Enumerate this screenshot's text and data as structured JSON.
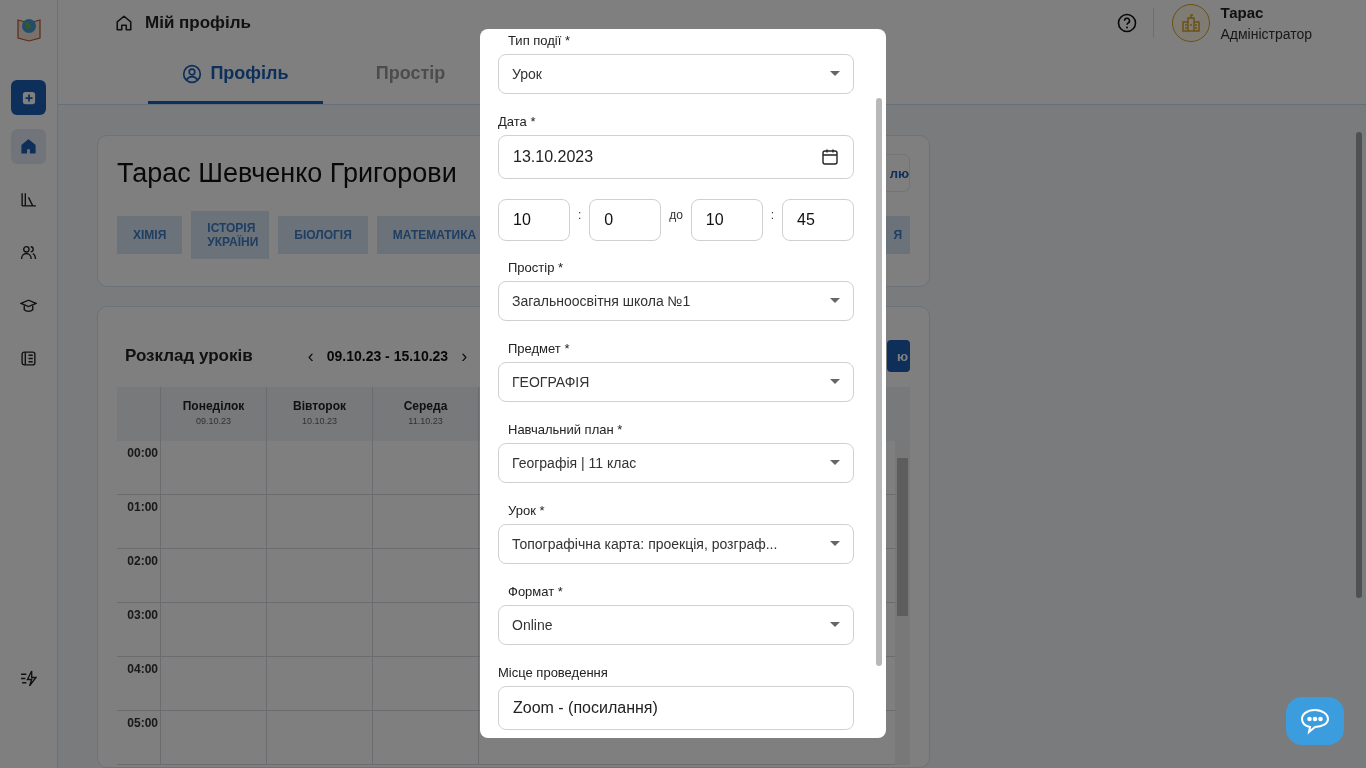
{
  "sidebar": {
    "items": [
      {
        "kind": "add",
        "selected": false
      },
      {
        "kind": "home",
        "selected": true
      },
      {
        "kind": "library",
        "selected": false
      },
      {
        "kind": "people",
        "selected": false
      },
      {
        "kind": "graduation",
        "selected": false
      },
      {
        "kind": "journal",
        "selected": false
      }
    ],
    "footer": {
      "kind": "flash"
    }
  },
  "header": {
    "title": "Мій профіль",
    "user": {
      "name": "Тарас",
      "role": "Адміністратор"
    }
  },
  "tabs": [
    {
      "label": "Профіль",
      "selected": true
    },
    {
      "label": "Простір",
      "selected": false
    }
  ],
  "profile": {
    "name": "Тарас Шевченко Григорови",
    "action": "лю",
    "tags": [
      "ХІМІЯ",
      "ІСТОРІЯ УКРАЇНИ",
      "БІОЛОГІЯ",
      "МАТЕМАТИКА"
    ],
    "tag_fragment": "Я"
  },
  "schedule": {
    "title": "Розклад уроків",
    "prev": "‹",
    "range": "09.10.23 - 15.10.23",
    "next": "›",
    "button": "ю",
    "days": [
      {
        "name": "Понеділок",
        "date": "09.10.23"
      },
      {
        "name": "Вівторок",
        "date": "10.10.23"
      },
      {
        "name": "Середа",
        "date": "11.10.23"
      }
    ],
    "hours": [
      "00:00",
      "01:00",
      "02:00",
      "03:00",
      "04:00",
      "05:00"
    ]
  },
  "modal": {
    "fields": [
      {
        "kind": "select",
        "label": "Тип події *",
        "value": "Урок"
      },
      {
        "kind": "date",
        "label": "Дата *",
        "value": "13.10.2023"
      },
      {
        "kind": "time",
        "parts": [
          {
            "kind": "input",
            "text": "10"
          },
          {
            "kind": "sep",
            "text": ":"
          },
          {
            "kind": "input",
            "text": "0"
          },
          {
            "kind": "sep",
            "text": "до"
          },
          {
            "kind": "input",
            "text": "10"
          },
          {
            "kind": "sep",
            "text": ":"
          },
          {
            "kind": "input",
            "text": "45"
          }
        ]
      },
      {
        "kind": "select",
        "label": "Простір *",
        "value": "Загальноосвітня школа №1"
      },
      {
        "kind": "select",
        "label": "Предмет *",
        "value": "ГЕОГРАФІЯ"
      },
      {
        "kind": "select",
        "label": "Навчальний план *",
        "value": "Географія | 11 клас"
      },
      {
        "kind": "select",
        "label": "Урок *",
        "value": "Топографічна карта: проекція, розграф..."
      },
      {
        "kind": "select",
        "label": "Формат *",
        "value": "Online"
      },
      {
        "kind": "text",
        "label": "Місце проведення",
        "value": "Zoom - (посилання)"
      }
    ]
  }
}
